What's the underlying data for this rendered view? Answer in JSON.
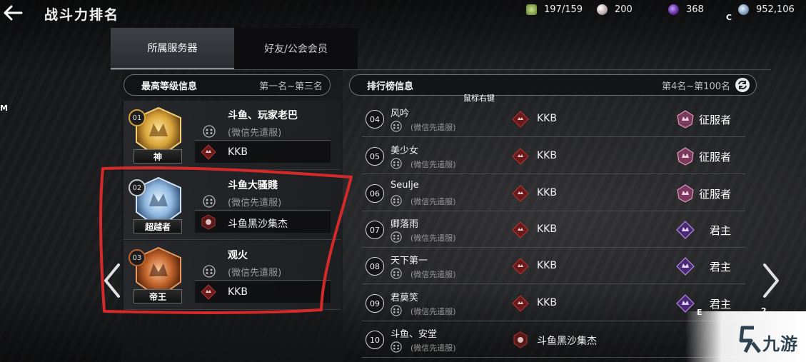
{
  "header": {
    "title": "战斗力排名",
    "resources": {
      "energy": "197/159",
      "pearl": "200",
      "gem": "368",
      "silver": "952,106"
    }
  },
  "hotkeys": {
    "c": "C",
    "m": "M",
    "e": "E",
    "two": "2"
  },
  "tabs": [
    {
      "label": "所属服务器",
      "active": true
    },
    {
      "label": "好友/公会会员",
      "active": false
    }
  ],
  "top_section": {
    "title": "最高等级信息",
    "range": "第一名~第三名",
    "entries": [
      {
        "rank": "01",
        "title": "神",
        "name": "斗鱼、玩家老巴",
        "server": "(微信先遣服)",
        "guild": "KKB"
      },
      {
        "rank": "02",
        "title": "超越者",
        "name": "斗鱼大骚賤",
        "server": "(微信先遣服)",
        "guild": "斗鱼黑沙集杰"
      },
      {
        "rank": "03",
        "title": "帝王",
        "name": "观火",
        "server": "(微信先遣服)",
        "guild": "KKB"
      }
    ]
  },
  "ranking_section": {
    "title": "排行榜信息",
    "range": "第4名~第100名",
    "context_tip": "鼠标右键",
    "rows": [
      {
        "rank": "04",
        "name": "风吟",
        "server": "(微信先遣服)",
        "guild": "KKB",
        "tier": "征服者"
      },
      {
        "rank": "05",
        "name": "美少女",
        "server": "(微信先遣服)",
        "guild": "KKB",
        "tier": "征服者"
      },
      {
        "rank": "06",
        "name": "Seulje",
        "server": "(微信先遣服)",
        "guild": "KKB",
        "tier": "征服者"
      },
      {
        "rank": "07",
        "name": "卿落雨",
        "server": "(微信先遣服)",
        "guild": "KKB",
        "tier": "君主"
      },
      {
        "rank": "08",
        "name": "天下第一",
        "server": "(微信先遣服)",
        "guild": "KKB",
        "tier": "君主"
      },
      {
        "rank": "09",
        "name": "君莫笑",
        "server": "(微信先遣服)",
        "guild": "KKB",
        "tier": "君主"
      },
      {
        "rank": "10",
        "name": "斗鱼、安堂",
        "server": "(微信先遣服)",
        "guild": "斗鱼黑沙集杰",
        "tier": ""
      }
    ]
  },
  "watermark": {
    "text": "九游"
  },
  "colors": {
    "annotation_red": "#d42a2a",
    "gold": "#d9a53a",
    "silver_blue": "#8fb7e0",
    "bronze": "#c0622a",
    "conqueror_pink": "#c66fa0",
    "lord_purple": "#9b5fd0"
  }
}
